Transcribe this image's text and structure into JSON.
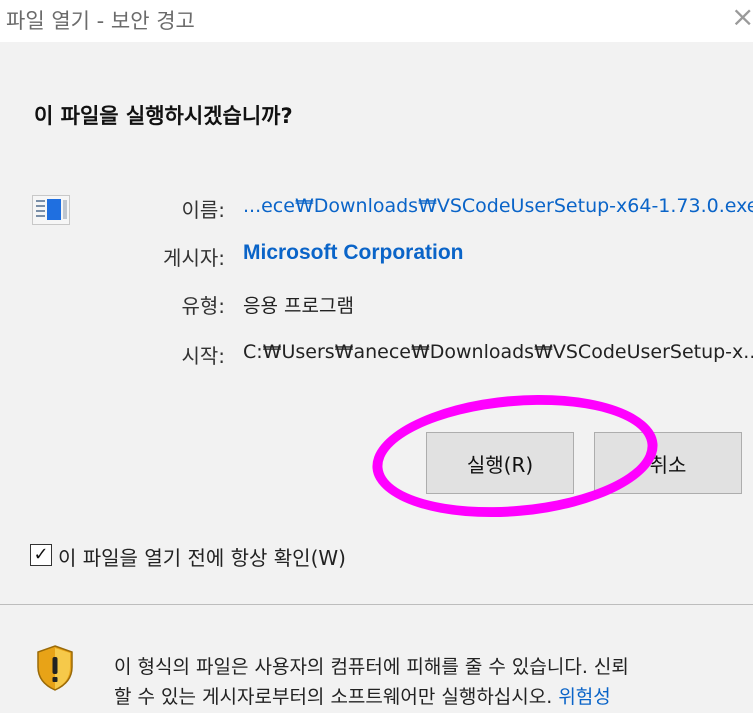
{
  "window": {
    "title": "파일 열기 - 보안 경고",
    "close_glyph": "×"
  },
  "question": "이 파일을 실행하시겠습니까?",
  "file_icon": "application-window-icon",
  "info": [
    {
      "label": "이름:",
      "value": "...ece₩Downloads₩VSCodeUserSetup-x64-1.73.0.exe",
      "style": "link"
    },
    {
      "label": "게시자:",
      "value": "Microsoft Corporation",
      "style": "bold-link"
    },
    {
      "label": "유형:",
      "value": "응용 프로그램",
      "style": "plain"
    },
    {
      "label": "시작:",
      "value": "C:₩Users₩anece₩Downloads₩VSCodeUserSetup-x...",
      "style": "plain"
    }
  ],
  "buttons": {
    "run": "실행(R)",
    "cancel": "취소"
  },
  "annotation": {
    "shape": "ellipse",
    "color": "#ff00ff",
    "target": "run-button"
  },
  "checkbox": {
    "checked": true,
    "mark": "✓",
    "label": "이 파일을 열기 전에 항상 확인(W)"
  },
  "warning": {
    "icon": "shield-warning-icon",
    "line1": "이 형식의 파일은 사용자의 컴퓨터에 피해를 줄 수 있습니다. 신뢰",
    "line2": "할 수 있는 게시자로부터의 소프트웨어만 실행하십시오. ",
    "link": "위험성"
  },
  "colors": {
    "link": "#0a64c8",
    "annotation": "#ff00ff",
    "background": "#f2f2f2"
  }
}
